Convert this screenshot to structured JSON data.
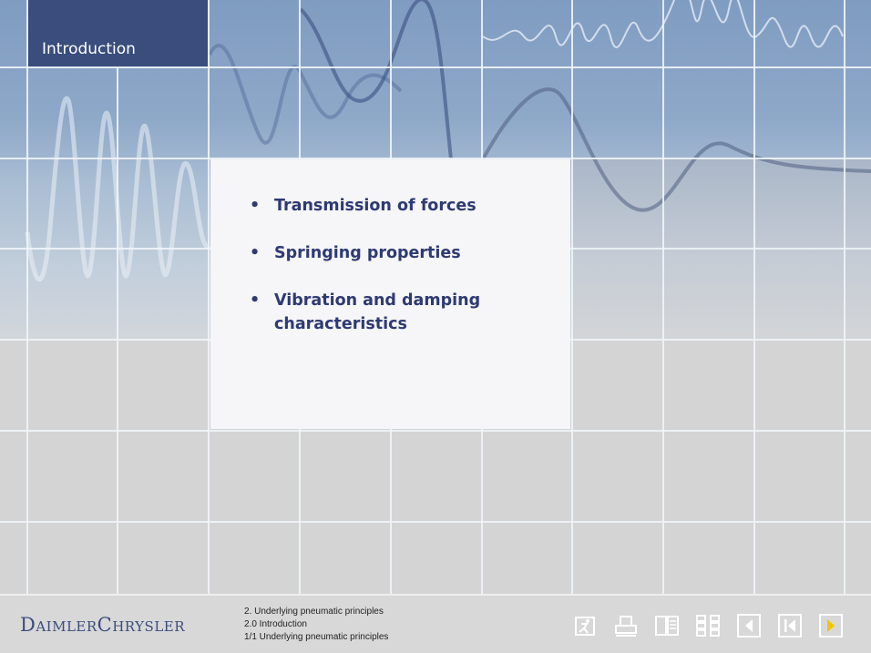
{
  "header": {
    "title": "Introduction"
  },
  "content": {
    "bullets": [
      {
        "text": "Transmission of forces"
      },
      {
        "text": "Springing properties"
      },
      {
        "text": "Vibration and damping characteristics"
      }
    ]
  },
  "footer": {
    "logo": "DaimlerChrysler",
    "breadcrumb": [
      "2. Underlying pneumatic principles",
      "2.0 Introduction",
      "1/1 Underlying pneumatic principles"
    ],
    "nav_icons": [
      "exit-icon",
      "print-icon",
      "glossary-icon",
      "overview-icon",
      "previous-icon",
      "first-page-icon",
      "next-icon"
    ]
  },
  "colors": {
    "title_bg": "#3a4d7c",
    "bullet_text": "#2e3a72",
    "logo": "#3a4d7c",
    "next_arrow": "#f3c400"
  }
}
